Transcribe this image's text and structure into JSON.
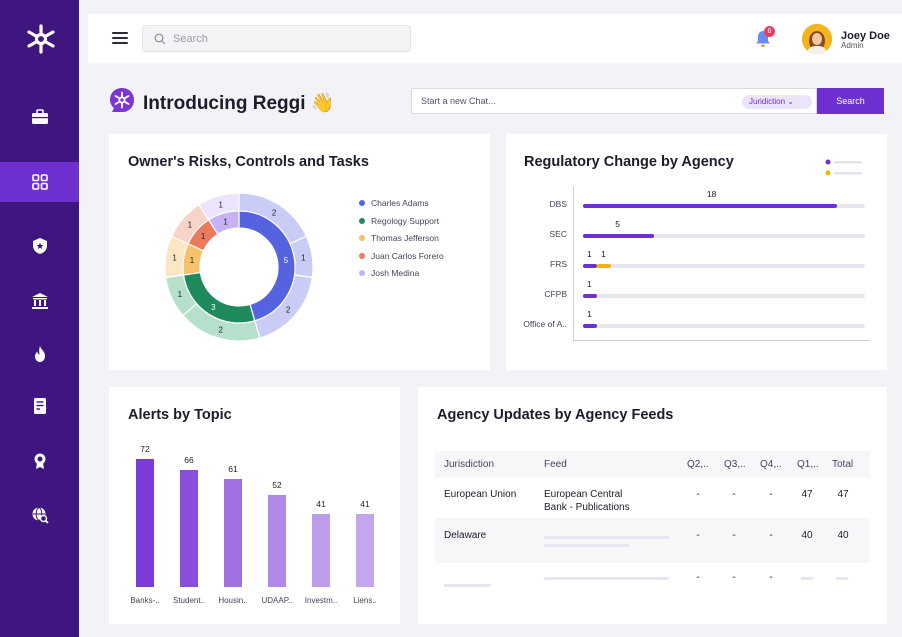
{
  "header": {
    "search_placeholder": "Search",
    "notification_count": "6",
    "user_name": "Joey Doe",
    "user_role": "Admin"
  },
  "sidebar": {
    "items": [
      {
        "icon": "briefcase-icon"
      },
      {
        "icon": "dashboard-grid-icon",
        "active": true
      },
      {
        "icon": "shield-star-icon"
      },
      {
        "icon": "bank-icon"
      },
      {
        "icon": "fire-icon"
      },
      {
        "icon": "checklist-icon"
      },
      {
        "icon": "award-badge-icon"
      },
      {
        "icon": "globe-search-icon"
      }
    ]
  },
  "reggi": {
    "title": "Introducing Reggi 👋",
    "chat_placeholder": "Start a new Chat...",
    "jurisdiction_label": "Juridiction",
    "search_button": "Search"
  },
  "owners_chart": {
    "title": "Owner's Risks, Controls and Tasks",
    "legend": [
      {
        "label": "Charles Adams",
        "color": "#5563e0"
      },
      {
        "label": "Regology Support",
        "color": "#1f8a5b"
      },
      {
        "label": "Thomas Jefferson",
        "color": "#f6c36b"
      },
      {
        "label": "Juan Carlos Forero",
        "color": "#ec7a5c"
      },
      {
        "label": "Josh Medina",
        "color": "#c7b2f7"
      }
    ]
  },
  "chart_data": [
    {
      "type": "pie",
      "title": "Owner's Risks, Controls and Tasks",
      "inner_ring": [
        {
          "name": "Charles Adams",
          "value": 5,
          "color": "#5563e0"
        },
        {
          "name": "Regology Support",
          "value": 3,
          "color": "#1f8a5b"
        },
        {
          "name": "Thomas Jefferson",
          "value": 1,
          "color": "#f6c36b"
        },
        {
          "name": "Juan Carlos Forero",
          "value": 1,
          "color": "#ec7a5c"
        },
        {
          "name": "Josh Medina",
          "value": 1,
          "color": "#c7b2f7"
        }
      ],
      "outer_ring": [
        {
          "name": "Charles Adams",
          "value": 2,
          "color": "#c9cdf6"
        },
        {
          "name": "Charles Adams",
          "value": 1,
          "color": "#c9cdf6"
        },
        {
          "name": "Charles Adams",
          "value": 2,
          "color": "#c9cdf6"
        },
        {
          "name": "Regology Support",
          "value": 2,
          "color": "#b5e0cc"
        },
        {
          "name": "Regology Support",
          "value": 1,
          "color": "#b5e0cc"
        },
        {
          "name": "Thomas Jefferson",
          "value": 1,
          "color": "#fbe6c6"
        },
        {
          "name": "Juan Carlos Forero",
          "value": 1,
          "color": "#f9d3c8"
        },
        {
          "name": "Josh Medina",
          "value": 1,
          "color": "#ece4fc"
        }
      ]
    },
    {
      "type": "bar",
      "title": "Regulatory Change by Agency",
      "categories": [
        "DBS",
        "SEC",
        "FRS",
        "CFPB",
        "Office of A.."
      ],
      "series": [
        {
          "values": [
            18,
            5,
            1,
            1,
            1
          ],
          "color": "#6d2fd0"
        },
        {
          "values": [
            0,
            0,
            1,
            0,
            0
          ],
          "color": "#f5b400"
        }
      ],
      "xlim": [
        0,
        20
      ],
      "orientation": "horizontal"
    },
    {
      "type": "bar",
      "title": "Alerts by Topic",
      "categories": [
        "Banks-..",
        "Student..",
        "Housin..",
        "UDAAP..",
        "Investm..",
        "Liens.."
      ],
      "values": [
        72,
        66,
        61,
        52,
        41,
        41
      ],
      "colors": [
        "#7d3cd8",
        "#8a4edc",
        "#a070e2",
        "#b08ae6",
        "#bb9dea",
        "#c3a7ec"
      ],
      "ylim": [
        0,
        80
      ]
    }
  ],
  "agency_table": {
    "title": "Agency Updates by Agency Feeds",
    "columns": [
      "Jurisdiction",
      "Feed",
      "Q2,..",
      "Q3,..",
      "Q4,..",
      "Q1,..",
      "Total"
    ],
    "rows": [
      {
        "jurisdiction": "European Union",
        "feed_line1": "European Central",
        "feed_line2": "Bank - Publications",
        "q2": "-",
        "q3": "-",
        "q4": "-",
        "q1": "47",
        "total": "47"
      },
      {
        "jurisdiction": "Delaware",
        "feed_line1": "",
        "feed_line2": "",
        "q2": "-",
        "q3": "-",
        "q4": "-",
        "q1": "40",
        "total": "40"
      },
      {
        "jurisdiction": "",
        "feed_line1": "",
        "feed_line2": "",
        "q2": "-",
        "q3": "-",
        "q4": "-",
        "q1": "",
        "total": ""
      }
    ]
  }
}
